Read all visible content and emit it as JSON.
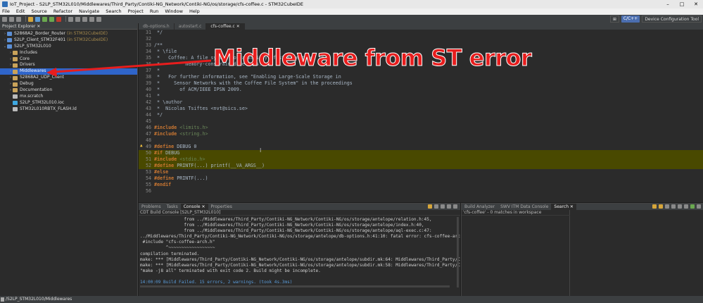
{
  "window": {
    "title": "IoT_Project - S2LP_STM32L010/Middlewares/Third_Party/Contiki-NG_Network/Contiki-NG/os/storage/cfs-coffee.c - STM32CubeIDE",
    "controls": [
      "–",
      "□",
      "✕"
    ]
  },
  "menu": [
    "File",
    "Edit",
    "Source",
    "Refactor",
    "Navigate",
    "Search",
    "Project",
    "Run",
    "Window",
    "Help"
  ],
  "perspectives": {
    "cpp": "C/C++",
    "device": "Device Configuration Tool"
  },
  "explorer": {
    "title": "Project Explorer ✕",
    "items": [
      {
        "label": "S2868A2_Border_Router",
        "suffix": "(in STM32CubeIDE)",
        "arrow": "›",
        "level": "project",
        "color": "#5b8fd6"
      },
      {
        "label": "S2LP_Client_STM32F401",
        "suffix": "(in STM32CubeIDE)",
        "arrow": "›",
        "level": "project",
        "color": "#5b8fd6"
      },
      {
        "label": "S2LP_STM32L010",
        "suffix": "",
        "arrow": "⌄",
        "level": "project",
        "color": "#5b8fd6"
      },
      {
        "label": "Includes",
        "suffix": "",
        "arrow": "›",
        "level": "child",
        "color": "#c9a35a"
      },
      {
        "label": "Core",
        "suffix": "",
        "arrow": "›",
        "level": "child",
        "color": "#c9a35a"
      },
      {
        "label": "Drivers",
        "suffix": "",
        "arrow": "›",
        "level": "child",
        "color": "#c9a35a"
      },
      {
        "label": "Middlewares",
        "suffix": "",
        "arrow": "›",
        "level": "child",
        "color": "#c9a35a",
        "selected": true
      },
      {
        "label": "S2868A2_UDP_Client",
        "suffix": "",
        "arrow": "›",
        "level": "child",
        "color": "#c9a35a"
      },
      {
        "label": "Debug",
        "suffix": "",
        "arrow": "›",
        "level": "child",
        "color": "#c9a35a"
      },
      {
        "label": "Documentation",
        "suffix": "",
        "arrow": "›",
        "level": "child",
        "color": "#c9a35a"
      },
      {
        "label": "mx.scratch",
        "suffix": "",
        "arrow": "",
        "level": "child",
        "color": "#bbbbbb"
      },
      {
        "label": "S2LP_STM32L010.ioc",
        "suffix": "",
        "arrow": "",
        "level": "child",
        "color": "#3ea7e0"
      },
      {
        "label": "STM32L010RBTX_FLASH.ld",
        "suffix": "",
        "arrow": "",
        "level": "child",
        "color": "#bbbbbb"
      }
    ]
  },
  "editor": {
    "tabs": [
      {
        "label": "db-options.h",
        "active": false
      },
      {
        "label": "autostart.c",
        "active": false
      },
      {
        "label": "cfs-coffee.c ✕",
        "active": true
      }
    ],
    "lines": [
      {
        "n": "31",
        "text": " */",
        "cls": "c-comment"
      },
      {
        "n": "32",
        "text": "",
        "cls": "c-plain"
      },
      {
        "n": "33",
        "text": "/**",
        "cls": "c-comment"
      },
      {
        "n": "34",
        "text": " * \\file",
        "cls": "c-comment"
      },
      {
        "n": "35",
        "text": " *   Coffee: A file system for a variety of storage types in",
        "cls": "c-comment"
      },
      {
        "n": "36",
        "text": " *         memory-constrained devices.",
        "cls": "c-comment"
      },
      {
        "n": "37",
        "text": " *",
        "cls": "c-comment"
      },
      {
        "n": "38",
        "text": " *   For further information, see \"Enabling Large-Scale Storage in",
        "cls": "c-comment"
      },
      {
        "n": "39",
        "text": " *     Sensor Networks with the Coffee File System\" in the proceedings",
        "cls": "c-comment"
      },
      {
        "n": "40",
        "text": " *       of ACM/IEEE IPSN 2009.",
        "cls": "c-comment"
      },
      {
        "n": "41",
        "text": " *",
        "cls": "c-comment"
      },
      {
        "n": "42",
        "text": " * \\author",
        "cls": "c-comment"
      },
      {
        "n": "43",
        "text": " *  Nicolas Tsiftes <nvt@sics.se>",
        "cls": "c-comment"
      },
      {
        "n": "44",
        "text": " */",
        "cls": "c-comment"
      },
      {
        "n": "45",
        "text": "",
        "cls": "c-plain"
      },
      {
        "n": "46",
        "text": "#include <limits.h>",
        "cls": "inc"
      },
      {
        "n": "47",
        "text": "#include <string.h>",
        "cls": "inc"
      },
      {
        "n": "48",
        "text": "",
        "cls": "c-plain"
      },
      {
        "n": "49",
        "text": "#define DEBUG 0",
        "cls": "def",
        "warn": true
      },
      {
        "n": "50",
        "text": "#if DEBUG",
        "cls": "def",
        "hl": true
      },
      {
        "n": "51",
        "text": "#include <stdio.h>",
        "cls": "inc",
        "hl": true
      },
      {
        "n": "52",
        "text": "#define PRINTF(...) printf(__VA_ARGS__)",
        "cls": "def",
        "hl": true
      },
      {
        "n": "53",
        "text": "#else",
        "cls": "def"
      },
      {
        "n": "54",
        "text": "#define PRINTF(...)",
        "cls": "def"
      },
      {
        "n": "55",
        "text": "#endif",
        "cls": "def"
      },
      {
        "n": "56",
        "text": "",
        "cls": "c-plain"
      }
    ]
  },
  "annotation": {
    "text": "Middleware from ST error",
    "color": "#e81d1d"
  },
  "console": {
    "tabs": [
      {
        "label": "Problems",
        "active": false
      },
      {
        "label": "Tasks",
        "active": false
      },
      {
        "label": "Console ✕",
        "active": true
      },
      {
        "label": "Properties",
        "active": false
      }
    ],
    "header": "CDT Build Console [S2LP_STM32L010]",
    "lines": [
      {
        "t": "                 from ../Middlewares/Third_Party/Contiki-NG_Network/Contiki-NG/os/storage/antelope/relation.h:45,",
        "c": ""
      },
      {
        "t": "                 from ../Middlewares/Third_Party/Contiki-NG_Network/Contiki-NG/os/storage/antelope/index.h:40,",
        "c": ""
      },
      {
        "t": "                 from ../Middlewares/Third_Party/Contiki-NG_Network/Contiki-NG/os/storage/antelope/aql-exec.c:47:",
        "c": ""
      },
      {
        "t": "../Middlewares/Third_Party/Contiki-NG_Network/Contiki-NG/os/storage/antelope/db-options.h:41:10: fatal error: cfs-coffee-arch.h",
        "c": ""
      },
      {
        "t": " #include \"cfs-coffee-arch.h\"",
        "c": ""
      },
      {
        "t": "          ^~~~~~~~~~~~~~~~~~~",
        "c": ""
      },
      {
        "t": "compilation terminated.",
        "c": ""
      },
      {
        "t": "make: *** [Middlewares/Third_Party/Contiki-NG_Network/Contiki-NG/os/storage/antelope/subdir.mk:64: Middlewares/Third_Party/Conti",
        "c": ""
      },
      {
        "t": "make: *** [Middlewares/Third_Party/Contiki-NG_Network/Contiki-NG/os/storage/antelope/subdir.mk:58: Middlewares/Third_Party/Conti",
        "c": ""
      },
      {
        "t": "\"make -j8 all\" terminated with exit code 2. Build might be incomplete.",
        "c": ""
      },
      {
        "t": "",
        "c": ""
      },
      {
        "t": "14:00:09 Build Failed. 15 errors, 2 warnings. (took 4s.3ms)",
        "c": "blue"
      }
    ]
  },
  "search_panel": {
    "tabs": [
      {
        "label": "Build Analyzer",
        "active": false
      },
      {
        "label": "SWV ITM Data Console",
        "active": false
      },
      {
        "label": "Search ✕",
        "active": true
      }
    ],
    "result": "'cfs-coffee' - 0 matches in workspace"
  },
  "status": {
    "path": "/S2LP_STM32L010/Middlewares"
  }
}
